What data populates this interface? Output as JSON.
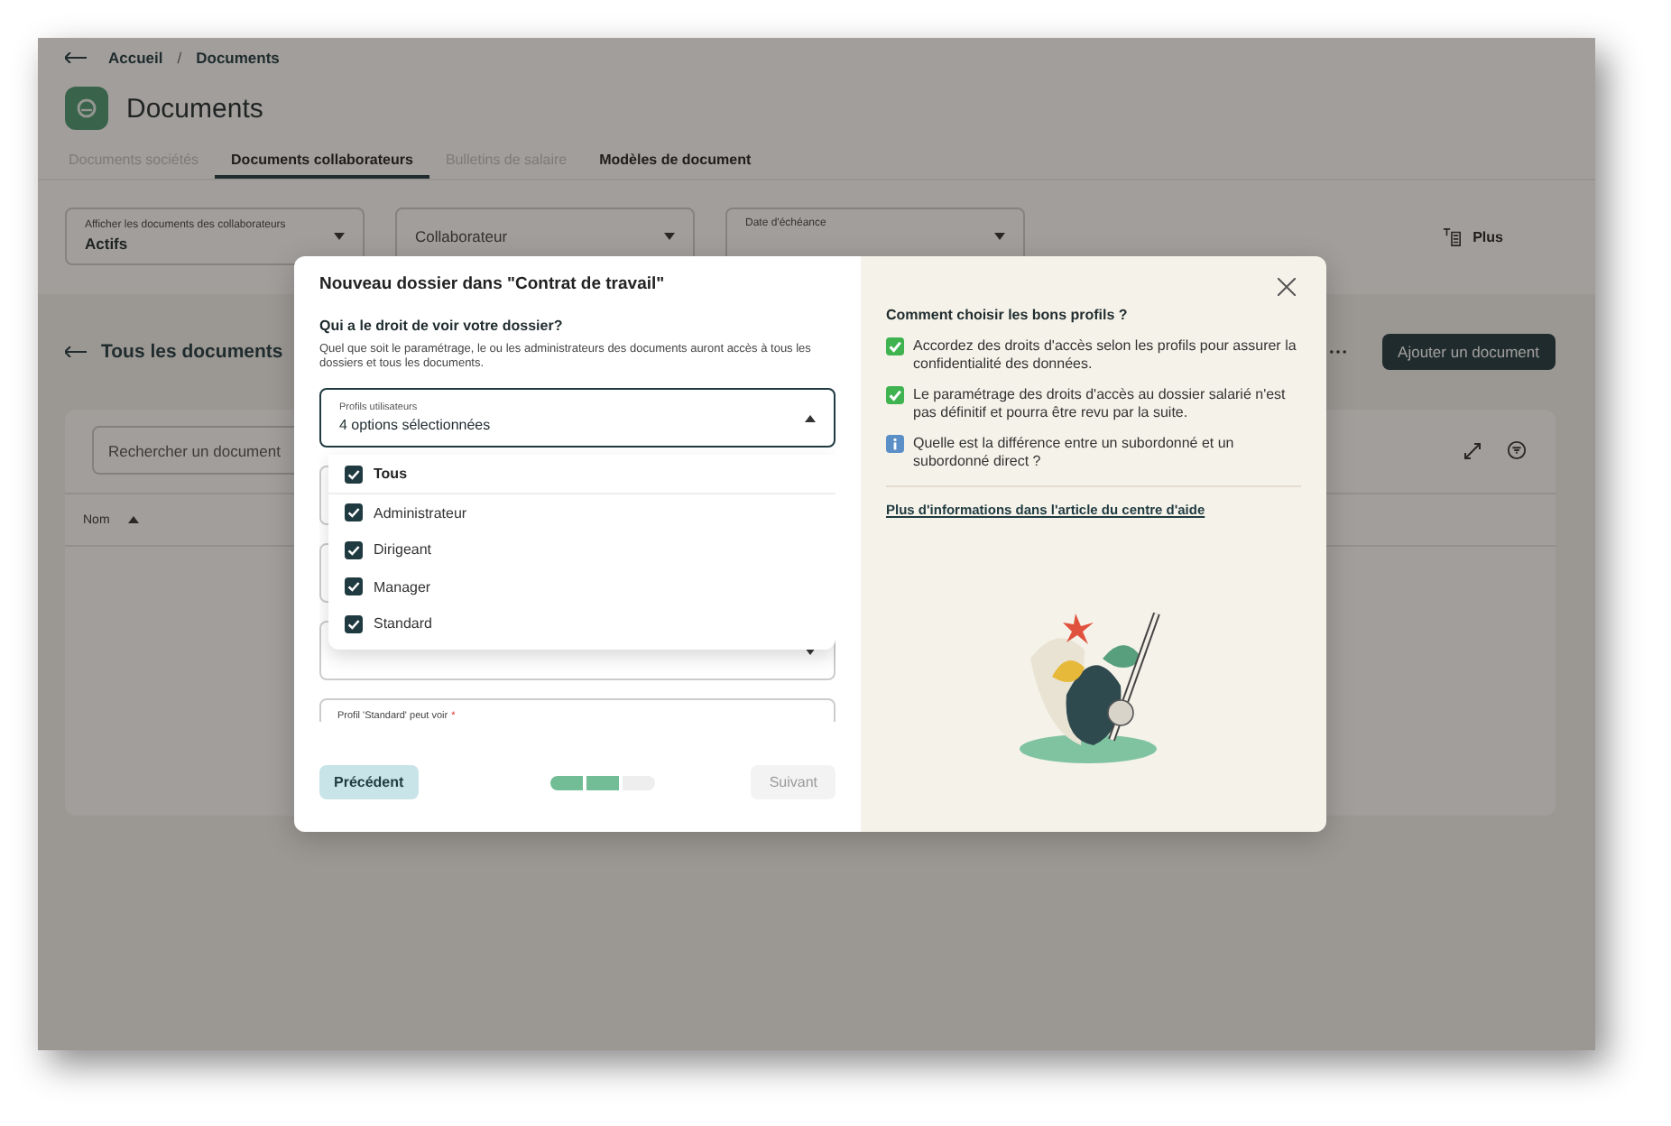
{
  "breadcrumb": [
    "Accueil",
    "Documents"
  ],
  "breadcrumb_separator": "/",
  "page_title": "Documents",
  "tabs": [
    {
      "label": "Documents sociétés",
      "selected": false,
      "disabled": true
    },
    {
      "label": "Documents collaborateurs",
      "selected": true,
      "disabled": false
    },
    {
      "label": "Bulletins de salaire",
      "selected": false,
      "disabled": true
    },
    {
      "label": "Modèles de document",
      "selected": false,
      "disabled": false
    }
  ],
  "filters": [
    {
      "label": "Afficher les documents des collaborateurs",
      "value": "Actifs"
    },
    {
      "placeholder": "Collaborateur"
    },
    {
      "label": "Date d'échéance"
    }
  ],
  "more_button": "Plus",
  "section_title": "Tous les documents",
  "add_button": "Ajouter un document",
  "search": {
    "placeholder": "Rechercher un document"
  },
  "table": {
    "columns": [
      {
        "label": "Nom",
        "sorted": true
      }
    ]
  },
  "modal": {
    "title": "Nouveau dossier dans \"Contrat de travail\"",
    "question": "Qui a le droit de voir votre dossier?",
    "help": "Quel que soit le paramétrage, le ou les administrateurs des documents auront accès à tous les dossiers et tous les documents.",
    "select": {
      "label": "Profils utilisateurs",
      "value": "4 options sélectionnées",
      "expanded": true
    },
    "options": [
      {
        "label": "Tous",
        "checked": true
      },
      {
        "label": "Administrateur",
        "checked": true
      },
      {
        "label": "Dirigeant",
        "checked": true
      },
      {
        "label": "Manager",
        "checked": true
      },
      {
        "label": "Standard",
        "checked": true
      }
    ],
    "fields": [
      {
        "kind": "select"
      },
      {
        "kind": "select"
      },
      {
        "kind": "select"
      },
      {
        "kind": "text",
        "label": "Profil 'Standard' peut voir",
        "required": true,
        "required_mark": "*"
      }
    ],
    "back_button": "Précédent",
    "steps": [
      {
        "done": true
      },
      {
        "done": true
      },
      {
        "done": false
      }
    ],
    "next_button": {
      "label": "Suivant",
      "disabled": true
    },
    "aside": {
      "heading": "Comment choisir les bons profils ?",
      "tips": [
        {
          "kind": "check",
          "text": "Accordez des droits d'accès selon les profils pour assurer la confidentialité des données."
        },
        {
          "kind": "check",
          "text": "Le paramétrage des droits d'accès au dossier salarié n'est pas définitif et pourra être revu par la suite."
        },
        {
          "kind": "info",
          "text": "Quelle est la différence entre un subordonné et un subordonné direct ?"
        }
      ],
      "link": "Plus d'informations dans l'article du centre d'aide"
    }
  }
}
